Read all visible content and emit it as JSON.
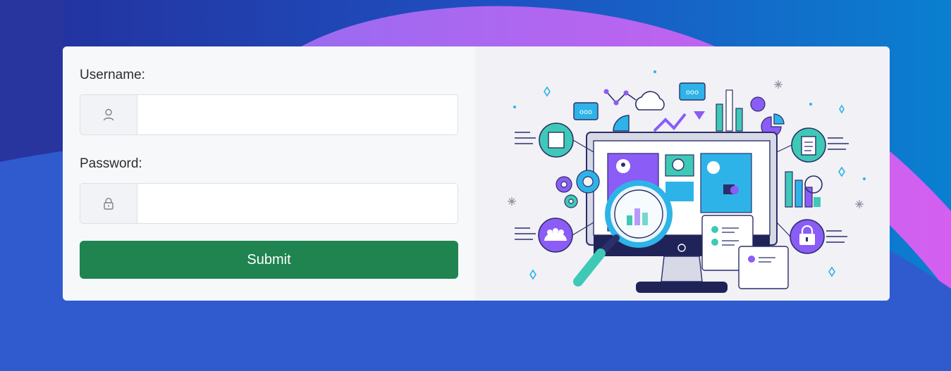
{
  "form": {
    "username_label": "Username:",
    "username_value": "",
    "password_label": "Password:",
    "password_value": "",
    "submit_label": "Submit"
  },
  "icons": {
    "username": "user-icon",
    "password": "lock-icon"
  },
  "colors": {
    "background": "#2f55c9",
    "card": "#f7f8fa",
    "submit": "#1f8450",
    "accent_purple": "#8b5cf6",
    "accent_teal": "#3ec9b6",
    "accent_blue": "#2eb3e8"
  }
}
